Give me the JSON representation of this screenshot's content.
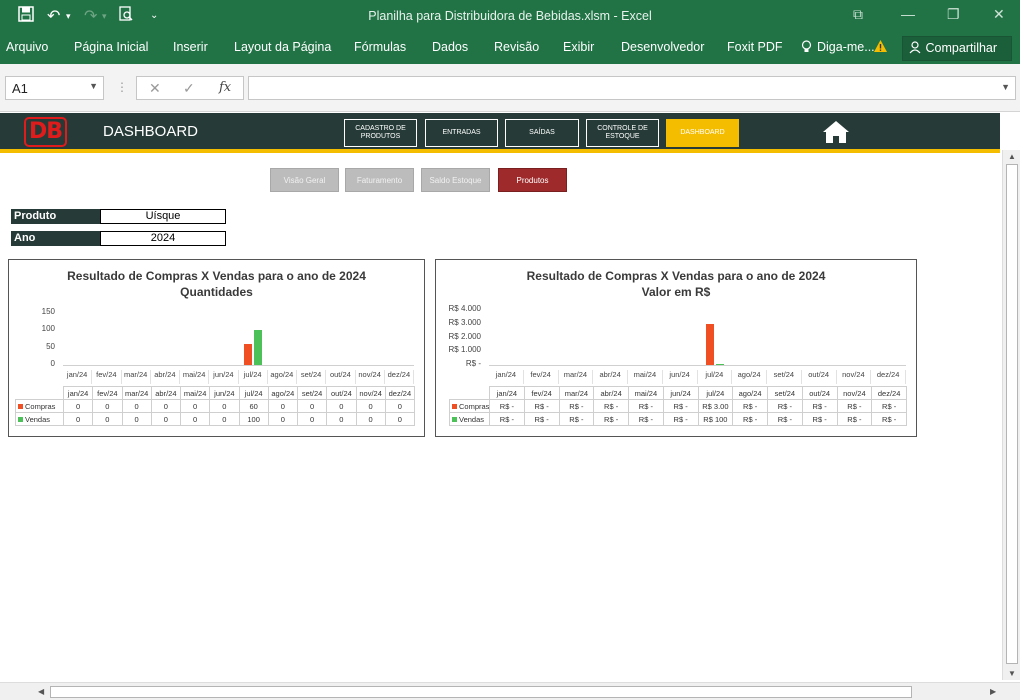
{
  "app": {
    "window_title": "Planilha para Distribuidora de Bebidas.xlsm - Excel"
  },
  "ribbon": {
    "tabs": [
      "Arquivo",
      "Página Inicial",
      "Inserir",
      "Layout da Página",
      "Fórmulas",
      "Dados",
      "Revisão",
      "Exibir",
      "Desenvolvedor",
      "Foxit PDF"
    ],
    "tell_me": "Diga-me...",
    "share": "Compartilhar"
  },
  "formula_bar": {
    "name_box": "A1",
    "fx": "fx",
    "value": ""
  },
  "dashboard": {
    "logo": "DB",
    "title": "DASHBOARD",
    "nav": [
      {
        "label": "CADASTRO DE PRODUTOS"
      },
      {
        "label": "ENTRADAS"
      },
      {
        "label": "SAÍDAS"
      },
      {
        "label": "CONTROLE DE ESTOQUE"
      },
      {
        "label": "DASHBOARD"
      }
    ],
    "sub_buttons": [
      "Visão Geral",
      "Faturamento",
      "Saldo Estoque",
      "Produtos"
    ],
    "filters": {
      "produto_label": "Produto",
      "produto_value": "Uísque",
      "ano_label": "Ano",
      "ano_value": "2024"
    }
  },
  "colors": {
    "compras": "#f04e23",
    "vendas": "#4cc158",
    "excel_green": "#217346",
    "header_dark": "#263b38",
    "accent_yellow": "#f5bd00",
    "active_red": "#9e2a2b"
  },
  "chart_data": [
    {
      "type": "bar",
      "title": "Resultado de Compras X Vendas para o ano de 2024",
      "subtitle": "Quantidades",
      "categories": [
        "jan/24",
        "fev/24",
        "mar/24",
        "abr/24",
        "mai/24",
        "jun/24",
        "jul/24",
        "ago/24",
        "set/24",
        "out/24",
        "nov/24",
        "dez/24"
      ],
      "series": [
        {
          "name": "Compras",
          "values": [
            0,
            0,
            0,
            0,
            0,
            0,
            60,
            0,
            0,
            0,
            0,
            0
          ]
        },
        {
          "name": "Vendas",
          "values": [
            0,
            0,
            0,
            0,
            0,
            0,
            100,
            0,
            0,
            0,
            0,
            0
          ]
        }
      ],
      "ytick_labels": [
        "150",
        "100",
        "50",
        "0"
      ],
      "ylim": [
        0,
        150
      ],
      "table_rows": [
        {
          "name": "Compras",
          "cells": [
            "0",
            "0",
            "0",
            "0",
            "0",
            "0",
            "60",
            "0",
            "0",
            "0",
            "0",
            "0"
          ]
        },
        {
          "name": "Vendas",
          "cells": [
            "0",
            "0",
            "0",
            "0",
            "0",
            "0",
            "100",
            "0",
            "0",
            "0",
            "0",
            "0"
          ]
        }
      ]
    },
    {
      "type": "bar",
      "title": "Resultado de Compras X Vendas para o ano de 2024",
      "subtitle": "Valor em R$",
      "categories": [
        "jan/24",
        "fev/24",
        "mar/24",
        "abr/24",
        "mai/24",
        "jun/24",
        "jul/24",
        "ago/24",
        "set/24",
        "out/24",
        "nov/24",
        "dez/24"
      ],
      "series": [
        {
          "name": "Compras",
          "values": [
            0,
            0,
            0,
            0,
            0,
            0,
            3000,
            0,
            0,
            0,
            0,
            0
          ]
        },
        {
          "name": "Vendas",
          "values": [
            0,
            0,
            0,
            0,
            0,
            0,
            100,
            0,
            0,
            0,
            0,
            0
          ]
        }
      ],
      "ytick_labels": [
        "R$ 4.000",
        "R$ 3.000",
        "R$ 2.000",
        "R$ 1.000",
        "R$ -"
      ],
      "ylim": [
        0,
        4000
      ],
      "table_rows": [
        {
          "name": "Compras",
          "cells": [
            "R$ -",
            "R$ -",
            "R$ -",
            "R$ -",
            "R$ -",
            "R$ -",
            "R$ 3.00",
            "R$ -",
            "R$ -",
            "R$ -",
            "R$ -",
            "R$ -"
          ]
        },
        {
          "name": "Vendas",
          "cells": [
            "R$ -",
            "R$ -",
            "R$ -",
            "R$ -",
            "R$ -",
            "R$ -",
            "R$ 100",
            "R$ -",
            "R$ -",
            "R$ -",
            "R$ -",
            "R$ -"
          ]
        }
      ]
    }
  ]
}
